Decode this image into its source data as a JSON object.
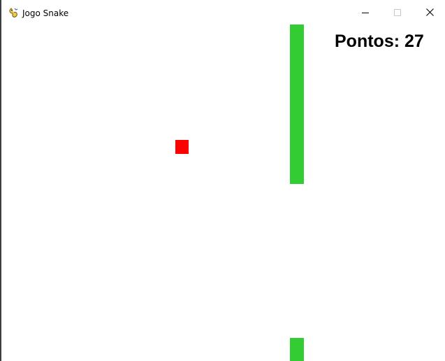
{
  "window": {
    "title": "Jogo Snake",
    "icon": "pygame-snake-icon"
  },
  "title_controls": {
    "minimize": "minimize-icon",
    "maximize": "maximize-icon",
    "close": "close-icon"
  },
  "game": {
    "score_text": "Pontos: 27",
    "snake_color": "#33cc33",
    "food_color": "#ff0000",
    "background_color": "#ffffff"
  }
}
